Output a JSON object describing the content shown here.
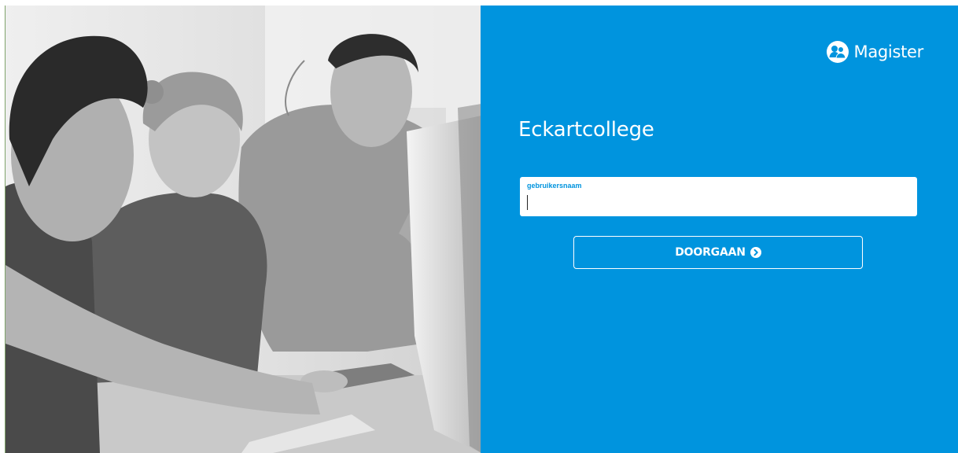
{
  "brand": {
    "name": "Magister",
    "icon": "users-icon"
  },
  "school": {
    "name": "Eckartcollege"
  },
  "login_form": {
    "username_label": "gebruikersnaam",
    "username_value": "",
    "continue_label": "DOORGAAN",
    "continue_icon": "arrow-circle-right-icon"
  },
  "photo": {
    "description_icon": "students-photo"
  },
  "colors": {
    "accent": "#0094de",
    "text_on_accent": "#ffffff"
  }
}
